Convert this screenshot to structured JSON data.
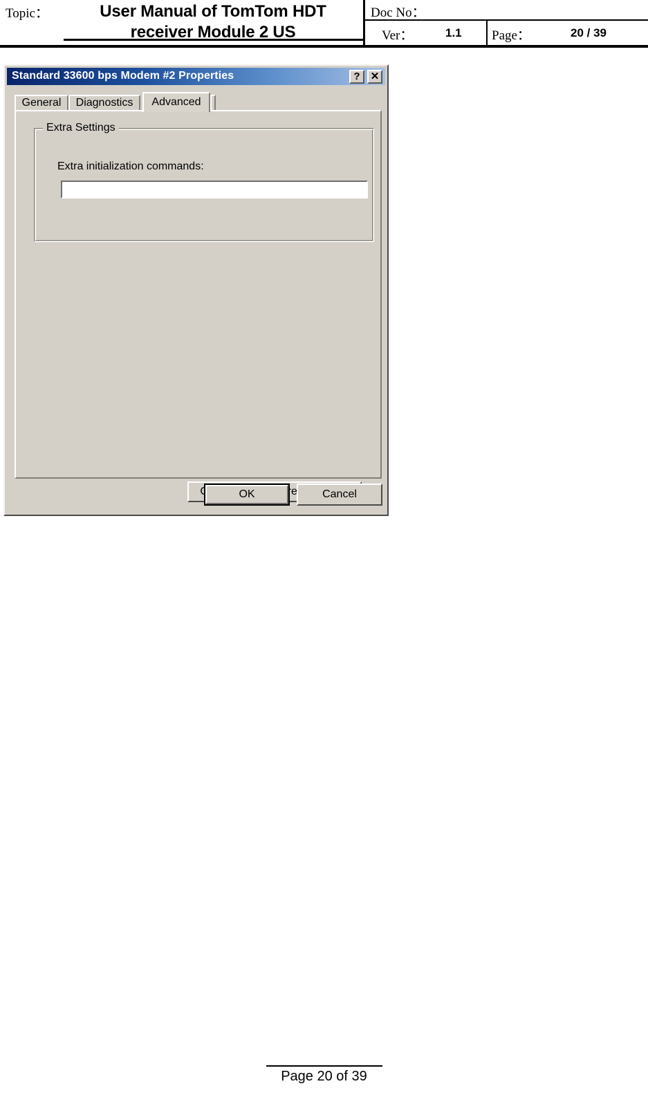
{
  "doc_header": {
    "topic_label": "Topic：",
    "title_line1": "User Manual of TomTom HDT",
    "title_line2": "receiver  Module 2 US",
    "doc_no_label": "Doc No：",
    "doc_no_value": "",
    "ver_label": "Ver：",
    "ver_value": "1.1",
    "page_label": "Page：",
    "page_value": "20 / 39"
  },
  "dialog": {
    "title": "Standard 33600 bps Modem #2 Properties",
    "help_icon": "?",
    "close_icon": "✕",
    "tabs": [
      {
        "label": "General",
        "selected": false
      },
      {
        "label": "Diagnostics",
        "selected": false
      },
      {
        "label": "Advanced",
        "selected": true
      }
    ],
    "group": {
      "legend": "Extra Settings",
      "field_label": "Extra initialization commands:",
      "field_value": "",
      "field_placeholder": ""
    },
    "buttons": {
      "change_prefs": "Change Default Preferences...",
      "ok": "OK",
      "cancel": "Cancel"
    },
    "colors": {
      "face": "#d4d0c8",
      "title_start": "#0a246a",
      "title_end": "#a6c0e3",
      "title_text": "#ffffff"
    }
  },
  "footer": {
    "page_text": "Page 20 of 39"
  }
}
